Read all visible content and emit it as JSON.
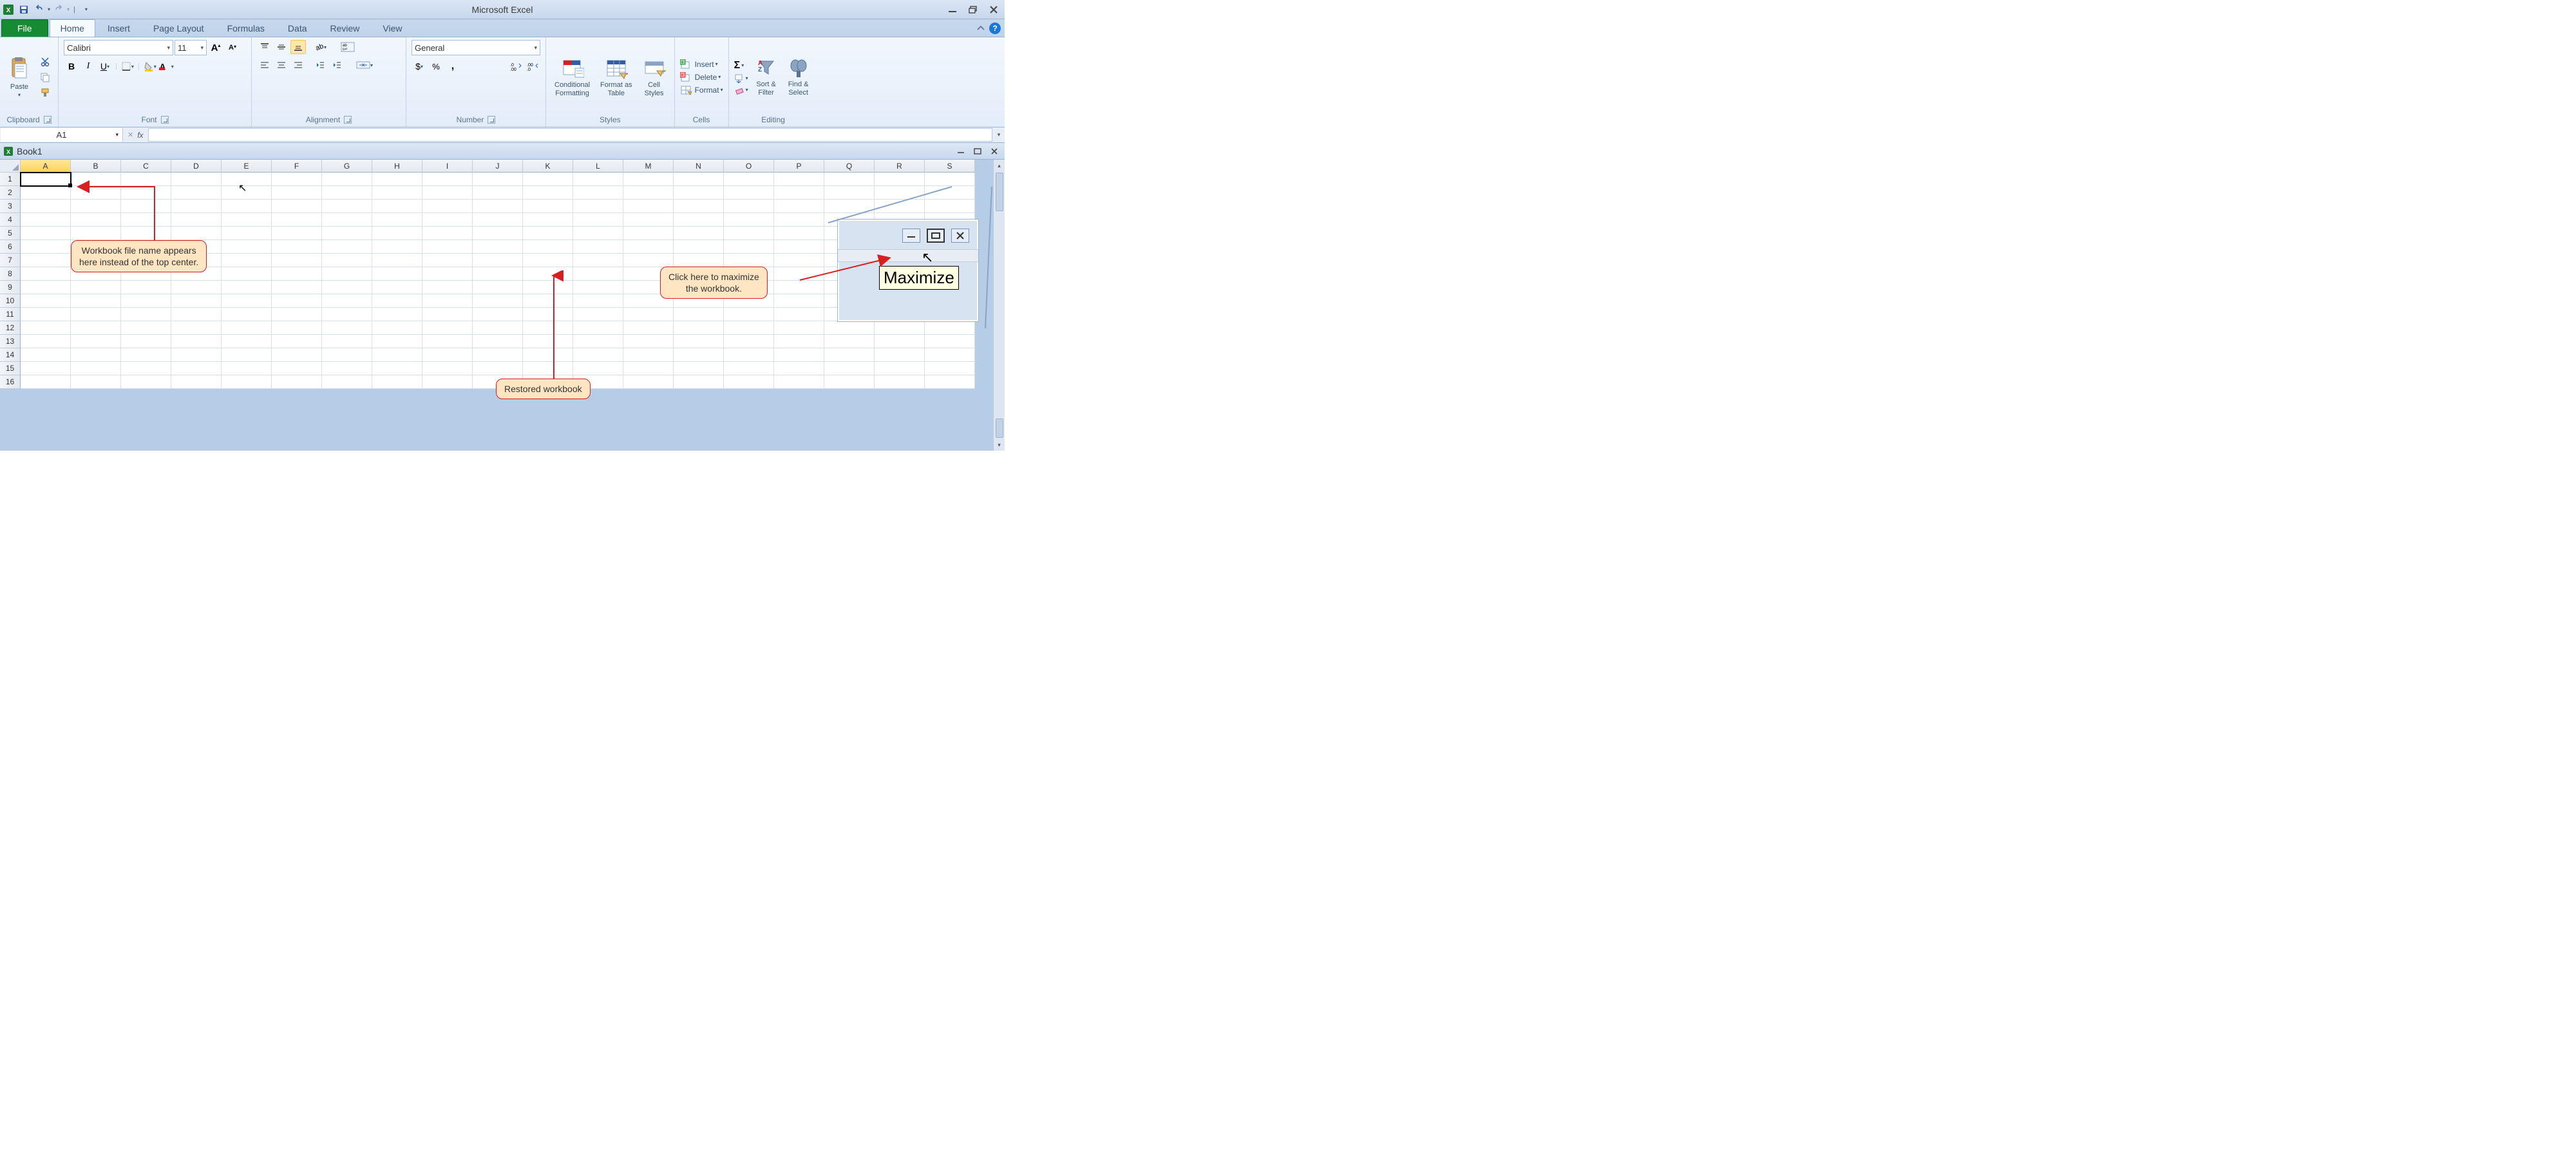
{
  "app_title": "Microsoft Excel",
  "qat": {
    "save": "Save",
    "undo": "Undo",
    "redo": "Redo"
  },
  "tabs": {
    "file": "File",
    "items": [
      "Home",
      "Insert",
      "Page Layout",
      "Formulas",
      "Data",
      "Review",
      "View"
    ],
    "active_index": 0
  },
  "ribbon": {
    "clipboard": {
      "label": "Clipboard",
      "paste": "Paste"
    },
    "font": {
      "label": "Font",
      "name": "Calibri",
      "size": "11",
      "bold": "B",
      "italic": "I",
      "underline": "U"
    },
    "alignment": {
      "label": "Alignment"
    },
    "number": {
      "label": "Number",
      "format": "General"
    },
    "styles": {
      "label": "Styles",
      "cf": "Conditional\nFormatting",
      "fat": "Format as\nTable",
      "cs": "Cell\nStyles"
    },
    "cells": {
      "label": "Cells",
      "insert": "Insert",
      "delete": "Delete",
      "format": "Format"
    },
    "editing": {
      "label": "Editing",
      "sort": "Sort &\nFilter",
      "find": "Find &\nSelect"
    }
  },
  "namebox": "A1",
  "workbook_title": "Book1",
  "columns": [
    "A",
    "B",
    "C",
    "D",
    "E",
    "F",
    "G",
    "H",
    "I",
    "J",
    "K",
    "L",
    "M",
    "N",
    "O",
    "P",
    "Q",
    "R",
    "S"
  ],
  "rows": [
    "1",
    "2",
    "3",
    "4",
    "5",
    "6",
    "7",
    "8",
    "9",
    "10",
    "11",
    "12",
    "13",
    "14",
    "15",
    "16"
  ],
  "callouts": {
    "filename": "Workbook file name appears\nhere instead of the top center.",
    "restored": "Restored workbook",
    "maximize": "Click here to maximize\nthe workbook."
  },
  "inset": {
    "tooltip": "Maximize"
  }
}
